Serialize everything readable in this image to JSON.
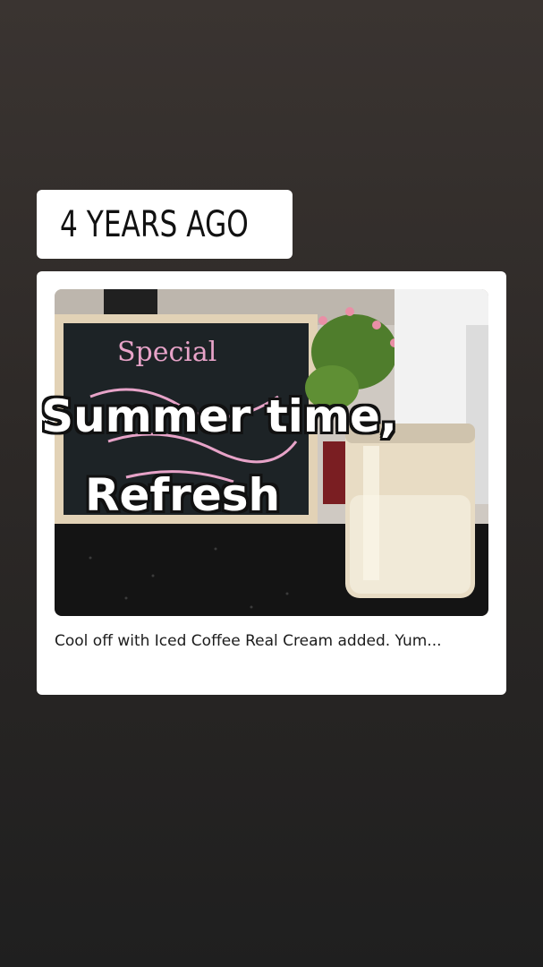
{
  "memory": {
    "label": "4 YEARS AGO",
    "icon": "history-clock-icon"
  },
  "post": {
    "caption": "Cool off with Iced Coffee  Real Cream added. Yum...",
    "photo_sign_text": "Special"
  },
  "overlay": {
    "line1": "Summer time,",
    "line2": "Refresh"
  },
  "colors": {
    "background": "#2d2927",
    "card": "#ffffff",
    "text": "#1c1c1c",
    "chalk": "#e7a3c8"
  }
}
